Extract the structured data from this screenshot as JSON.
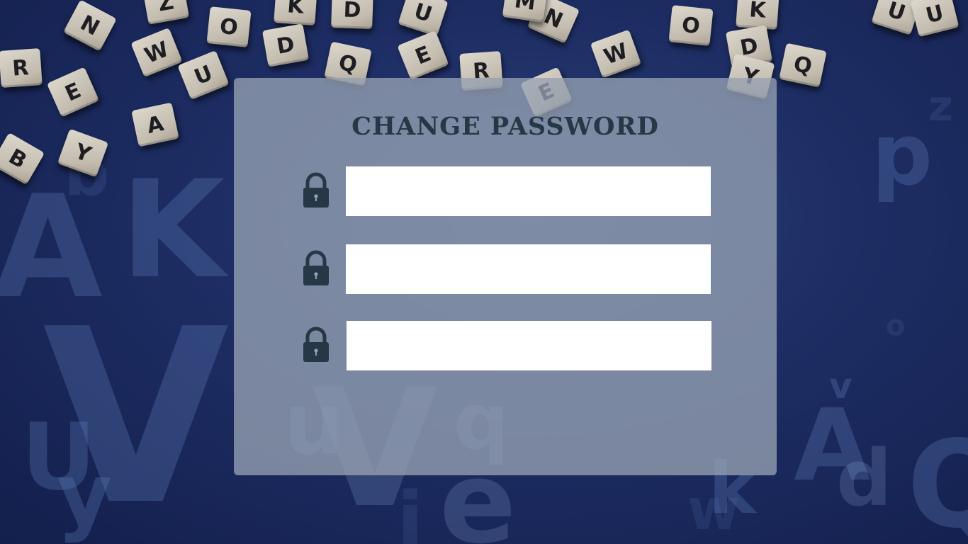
{
  "form": {
    "title": "CHANGE PASSWORD",
    "fields": [
      {
        "icon": "lock-icon",
        "value": "",
        "placeholder": ""
      },
      {
        "icon": "lock-icon",
        "value": "",
        "placeholder": ""
      },
      {
        "icon": "lock-icon",
        "value": "",
        "placeholder": ""
      }
    ]
  },
  "background": {
    "tile_letters": [
      "N",
      "O",
      "K",
      "D",
      "U",
      "Z",
      "W",
      "R",
      "E",
      "U",
      "Q",
      "A",
      "Y",
      "B",
      "D",
      "E",
      "N",
      "M",
      "W",
      "O",
      "K",
      "D",
      "U",
      "Y",
      "Q",
      "R",
      "E",
      "U"
    ],
    "large_letters": [
      "A",
      "V",
      "V",
      "U",
      "K",
      "A",
      "Q",
      "e",
      "p",
      "o",
      "v",
      "y",
      "d",
      "u",
      "b",
      "k",
      "w",
      "q",
      "i",
      "z"
    ]
  },
  "colors": {
    "background": "#1d2d63",
    "panel": "#96a2b2",
    "title_text": "#263746",
    "lock_icon": "#263746",
    "input_bg": "#ffffff",
    "tile": "#d4cec3"
  }
}
